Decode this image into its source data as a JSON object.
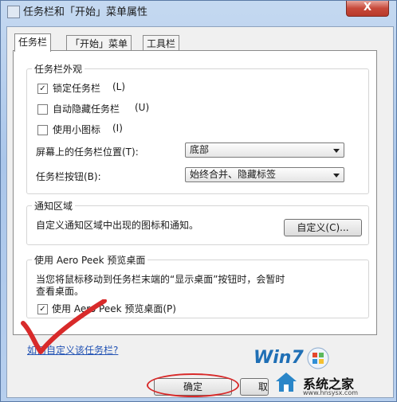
{
  "window": {
    "title": "任务栏和「开始」菜单属性",
    "close_label": "X"
  },
  "tabs": [
    {
      "label": "任务栏",
      "active": true
    },
    {
      "label": "「开始」菜单",
      "active": false
    },
    {
      "label": "工具栏",
      "active": false
    }
  ],
  "appearance": {
    "legend": "任务栏外观",
    "lock_label": "锁定任务栏",
    "lock_hotkey": "(L)",
    "lock_checked": true,
    "autohide_label": "自动隐藏任务栏",
    "autohide_hotkey": "(U)",
    "autohide_checked": false,
    "small_icons_label": "使用小图标",
    "small_icons_hotkey": "(I)",
    "small_icons_checked": false,
    "location_label": "屏幕上的任务栏位置(T):",
    "location_value": "底部",
    "buttons_label": "任务栏按钮(B):",
    "buttons_value": "始终合并、隐藏标签"
  },
  "notification": {
    "legend": "通知区域",
    "description": "自定义通知区域中出现的图标和通知。",
    "customize_button": "自定义(C)..."
  },
  "aero_peek": {
    "legend": "使用 Aero Peek 预览桌面",
    "description_line1": "当您将鼠标移动到任务栏末端的“显示桌面”按钮时，会暂时",
    "description_line2": "查看桌面。",
    "checkbox_label": "使用 Aero Peek 预览桌面(P)",
    "checkbox_checked": true
  },
  "help_link": "如何自定义该任务栏?",
  "footer": {
    "ok_button": "确定",
    "cancel_button": "取"
  },
  "watermark": {
    "logo": "Win7",
    "site_name": "系统之家",
    "url": "www.hnsysx.com"
  },
  "colors": {
    "annotation_red": "#d82a2a",
    "link_blue": "#2353b4",
    "close_red": "#c7493a"
  }
}
